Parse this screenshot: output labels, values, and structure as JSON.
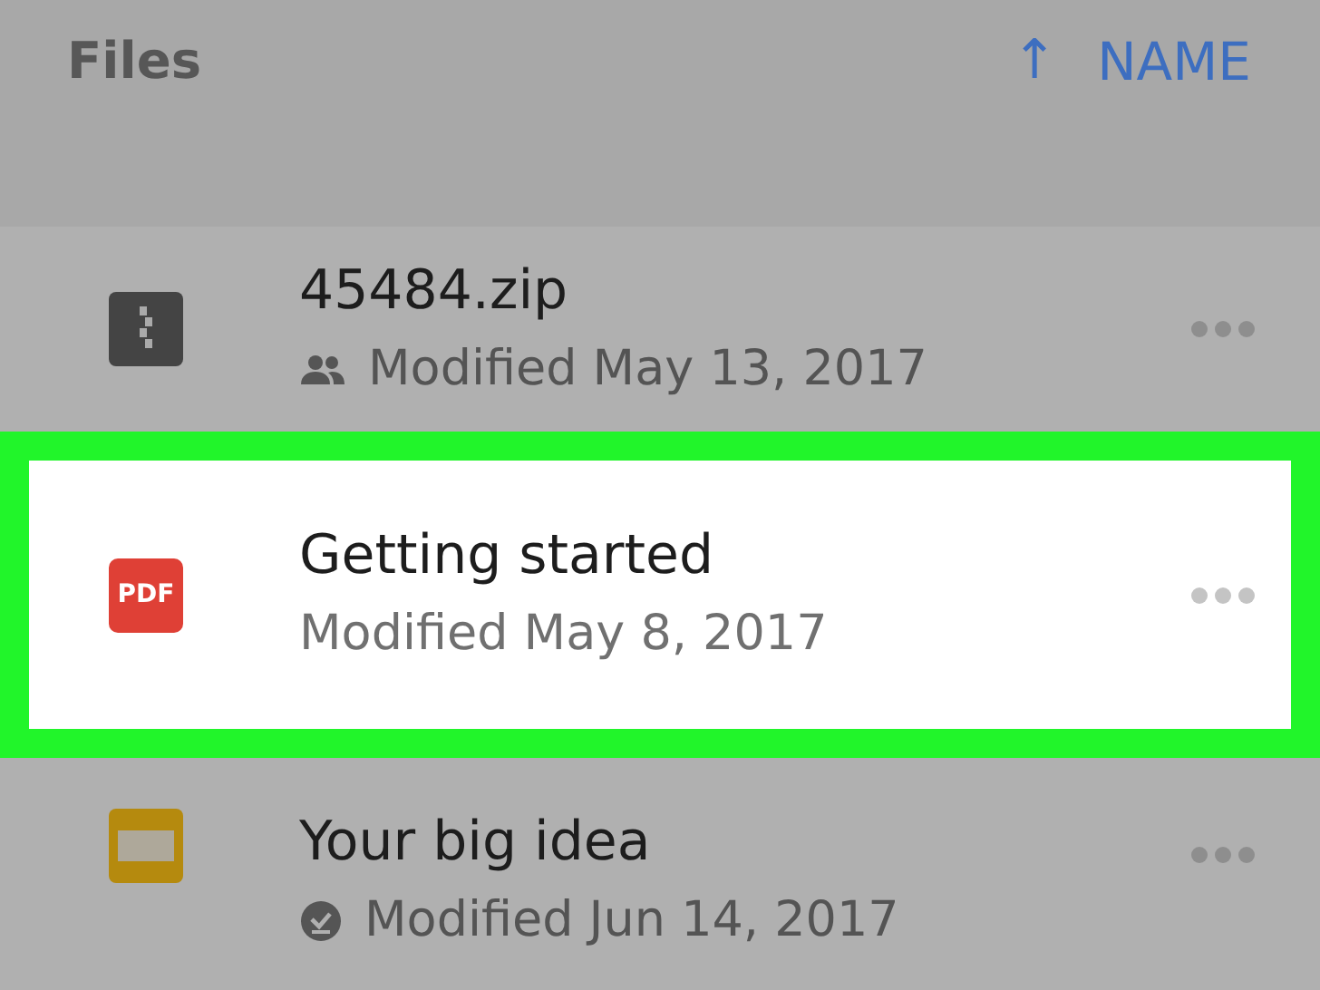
{
  "header": {
    "title": "Files",
    "sort_arrow": "↑",
    "sort_label": "NAME"
  },
  "files": [
    {
      "name": "45484.zip",
      "kind": "zip",
      "badge": {
        "kind": "shared"
      },
      "modified": "Modified May 13, 2017",
      "selected": false
    },
    {
      "name": "Getting started",
      "kind": "pdf",
      "pdf_label": "PDF",
      "modified": "Modified May 8, 2017",
      "selected": true
    },
    {
      "name": "Your big idea",
      "kind": "slides",
      "badge": {
        "kind": "offline"
      },
      "modified": "Modified Jun 14, 2017",
      "selected": false
    }
  ]
}
